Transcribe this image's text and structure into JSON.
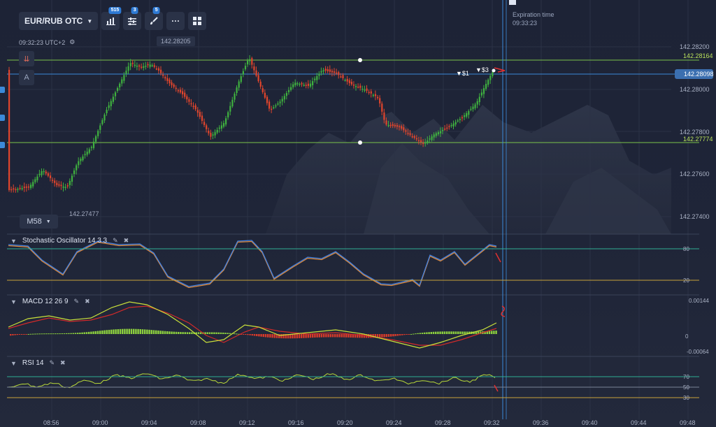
{
  "toolbar": {
    "pair_label": "EUR/RUB OTC",
    "indicators_badge": "515",
    "settings_badge": "3",
    "drawing_badge": "5",
    "more_label": "···"
  },
  "clock_text": "09:32:23 UTC+2",
  "price_chips": {
    "top": "142.28205",
    "bottom": "142.27477"
  },
  "timeframe_label": "M58",
  "expiration": {
    "title": "Expiration time",
    "time": "09:33:23"
  },
  "trades": [
    {
      "label": "▼$1"
    },
    {
      "label": "▼$3"
    }
  ],
  "price_axis": {
    "ticks": [
      "142.28200",
      "142.28000",
      "142.27800",
      "142.27600",
      "142.27400"
    ],
    "upper_level": "142.28164",
    "lower_level": "142.27774",
    "current": "142.28098"
  },
  "time_axis": [
    "08:56",
    "09:00",
    "09:04",
    "09:08",
    "09:12",
    "09:16",
    "09:20",
    "09:24",
    "09:28",
    "09:32",
    "09:36",
    "09:40",
    "09:44",
    "09:48"
  ],
  "panes": {
    "stochastic": {
      "title": "Stochastic Oscillator  14 3 3",
      "levels": [
        "80",
        "20"
      ]
    },
    "macd": {
      "title": "MACD  12 26 9",
      "levels": [
        "0.00144",
        "0",
        "-0.00064"
      ]
    },
    "rsi": {
      "title": "RSI  14",
      "levels": [
        "70",
        "50",
        "30"
      ]
    }
  },
  "side_buttons": {
    "down_arrows": "⇊",
    "text_tool": "A"
  },
  "colors": {
    "bull": "#3fb13f",
    "bear": "#e0452c",
    "level": "#6fbf3f",
    "accent": "#3b8ad9"
  }
}
